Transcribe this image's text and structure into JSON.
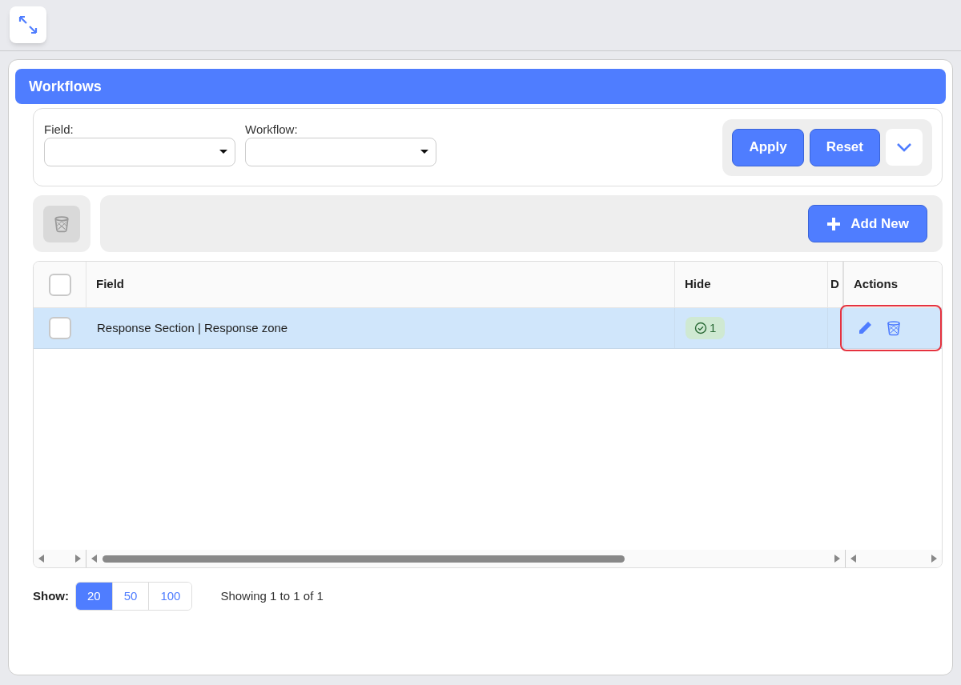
{
  "panel": {
    "title": "Workflows"
  },
  "filters": [
    {
      "label": "Field:"
    },
    {
      "label": "Workflow:"
    }
  ],
  "filter_buttons": [
    "Apply",
    "Reset"
  ],
  "add_button": "Add New",
  "table": {
    "columns": [
      "Field",
      "Hide",
      "D",
      "Actions"
    ],
    "header_checked": false,
    "rows": [
      {
        "checked": false,
        "selected": true,
        "field": "Response Section | Response zone",
        "hide": "1",
        "actions_highlighted": true
      }
    ]
  },
  "pagination": {
    "label": "Show:",
    "options": [
      {
        "label": "20",
        "selected": true
      },
      {
        "label": "50",
        "selected": false
      },
      {
        "label": "100",
        "selected": false
      }
    ],
    "summary": "Showing 1 to 1 of 1"
  }
}
